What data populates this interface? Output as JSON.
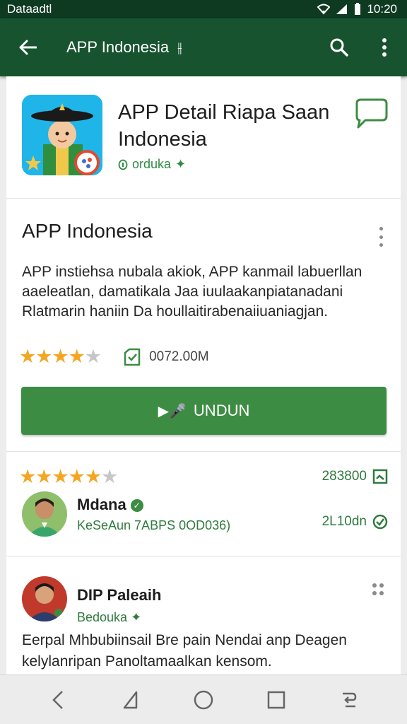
{
  "status_bar": {
    "carrier": "Dataadtl",
    "time": "10:20"
  },
  "app_bar": {
    "title": "APP Indonesia",
    "title_suffix": "⫲",
    "icons": [
      "back-arrow-icon",
      "search-icon",
      "more-vert-icon"
    ]
  },
  "app_header": {
    "title": "APP Detail Riapa Saan Indonesia",
    "developer": "orduka",
    "developer_badge": "✦",
    "chat_icon": "chat-bubble-icon"
  },
  "info": {
    "section_title": "APP Indonesia",
    "description": "APP instiehsa nubala akiok, APP kanmail labuerllan aaeleatlan, damatikala Jaa iuulaakanpiatanadani Rlatmarin haniin Da houllaitirabenaiiuaniagjan.",
    "rating": 4,
    "rating_max": 5,
    "stars": [
      "★",
      "★",
      "★",
      "★",
      "★"
    ],
    "size_text": "0072.00M",
    "install_label": "UNDUN",
    "install_icon": "▶🎤"
  },
  "review": {
    "rating": 5,
    "rating_max": 6,
    "stars": [
      "★",
      "★",
      "★",
      "★",
      "★",
      "★"
    ],
    "stat_top": "283800",
    "stat_bottom": "2L10dn",
    "name": "Mdana",
    "sub": "KeSeAun 7ABPS 0OD036)"
  },
  "comment": {
    "name": "DIP Paleaih",
    "sub": "Bedouka",
    "sub_badge": "✦",
    "text": "Eerpal Mhbubiinsail Bre pain Nendai anp Deagen kelylanripan Panoltamaalkan kensom."
  },
  "colors": {
    "primary_dark": "#17532f",
    "status_bar": "#0f3a22",
    "accent_green": "#3d8c43",
    "star": "#f4a623"
  },
  "nav_bar": {
    "icons": [
      "chevron-back-icon",
      "triangle-icon",
      "circle-home-icon",
      "square-recents-icon",
      "reply-icon"
    ]
  }
}
